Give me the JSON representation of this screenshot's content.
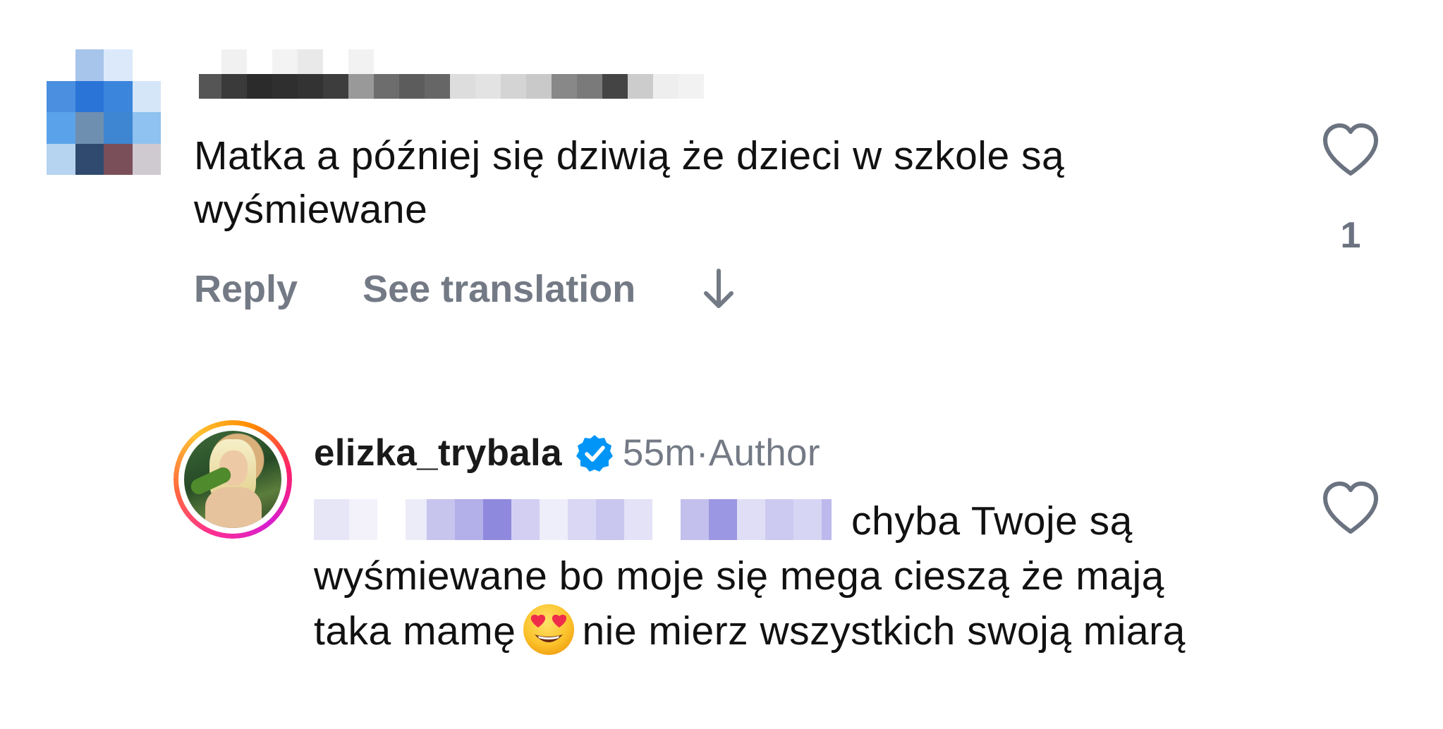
{
  "comment1": {
    "text": "Matka a później się dziwią że dzieci w szkole są wyśmiewane",
    "actions": {
      "reply_label": "Reply",
      "translate_label": "See translation"
    },
    "like_count": "1"
  },
  "comment2": {
    "username": "elizka_trybala",
    "time": "55m",
    "separator": "·",
    "author_badge": "Author",
    "text_line1": "chyba Twoje są wyśmiewane bo moje się mega cieszą że mają taka mamę",
    "text_after_emoji": "nie mierz wszystkich swoją miarą"
  },
  "icons": {
    "heart": "heart-outline-icon",
    "verified": "verified-badge-icon",
    "arrow": "arrow-down-icon",
    "emoji": "heart-eyes-emoji"
  },
  "colors": {
    "text": "#111111",
    "muted": "#737a85",
    "verified_blue": "#0095f6",
    "heart_outline": "#6b7280"
  }
}
